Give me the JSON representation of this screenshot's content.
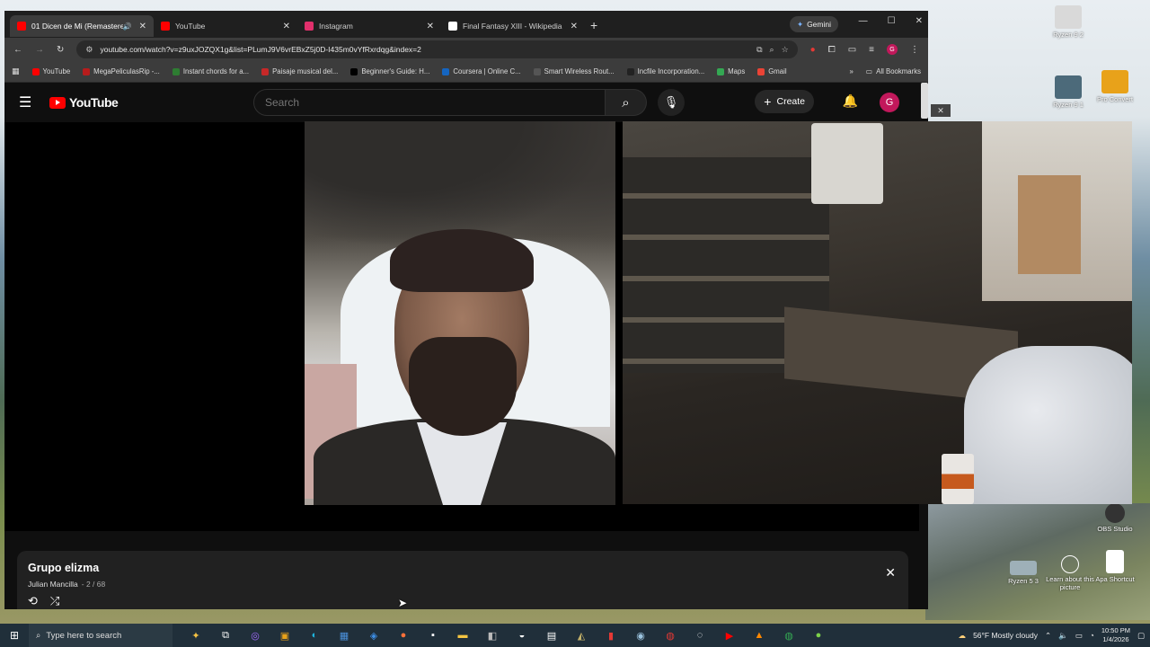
{
  "browser": {
    "tabs": [
      {
        "label": "01 Dicen de Mi (Remastere",
        "fav_color": "#ff0000",
        "active": true,
        "audio": true
      },
      {
        "label": "YouTube",
        "fav_color": "#ff0000",
        "active": false
      },
      {
        "label": "Instagram",
        "fav_color": "#e1306c",
        "active": false
      },
      {
        "label": "Final Fantasy XIII - Wikipedia",
        "fav_color": "#ffffff",
        "active": false
      }
    ],
    "gemini_label": "Gemini",
    "url": "youtube.com/watch?v=z9uxJOZQX1g&list=PLumJ9V6vrEBxZ5j0D-I435m0vYfRxrdqg&index=2",
    "bookmarks": [
      {
        "label": "YouTube",
        "color": "#ff0000"
      },
      {
        "label": "MegaPeliculasRip -...",
        "color": "#b71c1c"
      },
      {
        "label": "Instant chords for a...",
        "color": "#2e7d32"
      },
      {
        "label": "Paisaje musical del...",
        "color": "#c62828"
      },
      {
        "label": "Beginner's Guide: H...",
        "color": "#000000"
      },
      {
        "label": "Coursera | Online C...",
        "color": "#1565c0"
      },
      {
        "label": "Smart Wireless Rout...",
        "color": "#555555"
      },
      {
        "label": "Incfile Incorporation...",
        "color": "#222222"
      },
      {
        "label": "Maps",
        "color": "#34a853"
      },
      {
        "label": "Gmail",
        "color": "#ea4335"
      }
    ],
    "all_bookmarks": "All Bookmarks"
  },
  "youtube": {
    "logo": "YouTube",
    "search_placeholder": "Search",
    "create_label": "Create",
    "avatar_letter": "G",
    "playlist": {
      "title": "Grupo elizma",
      "owner": "Julian Mancilla",
      "count": "- 2 / 68"
    }
  },
  "desktop": {
    "icons": [
      {
        "label": "Ryzen 9 2"
      },
      {
        "label": "Ryzen 9 1"
      },
      {
        "label": "Pro Convert"
      },
      {
        "label": "OBS Studio"
      },
      {
        "label": "Ryzen 5 3"
      },
      {
        "label": "Learn about this picture"
      },
      {
        "label": "Apa Shortcut"
      }
    ]
  },
  "taskbar": {
    "search_placeholder": "Type here to search",
    "weather": "56°F  Mostly cloudy",
    "time": "10:50 PM",
    "date": "1/4/2026"
  },
  "colors": {
    "yt_red": "#ff0000",
    "avatar": "#c2185b"
  }
}
